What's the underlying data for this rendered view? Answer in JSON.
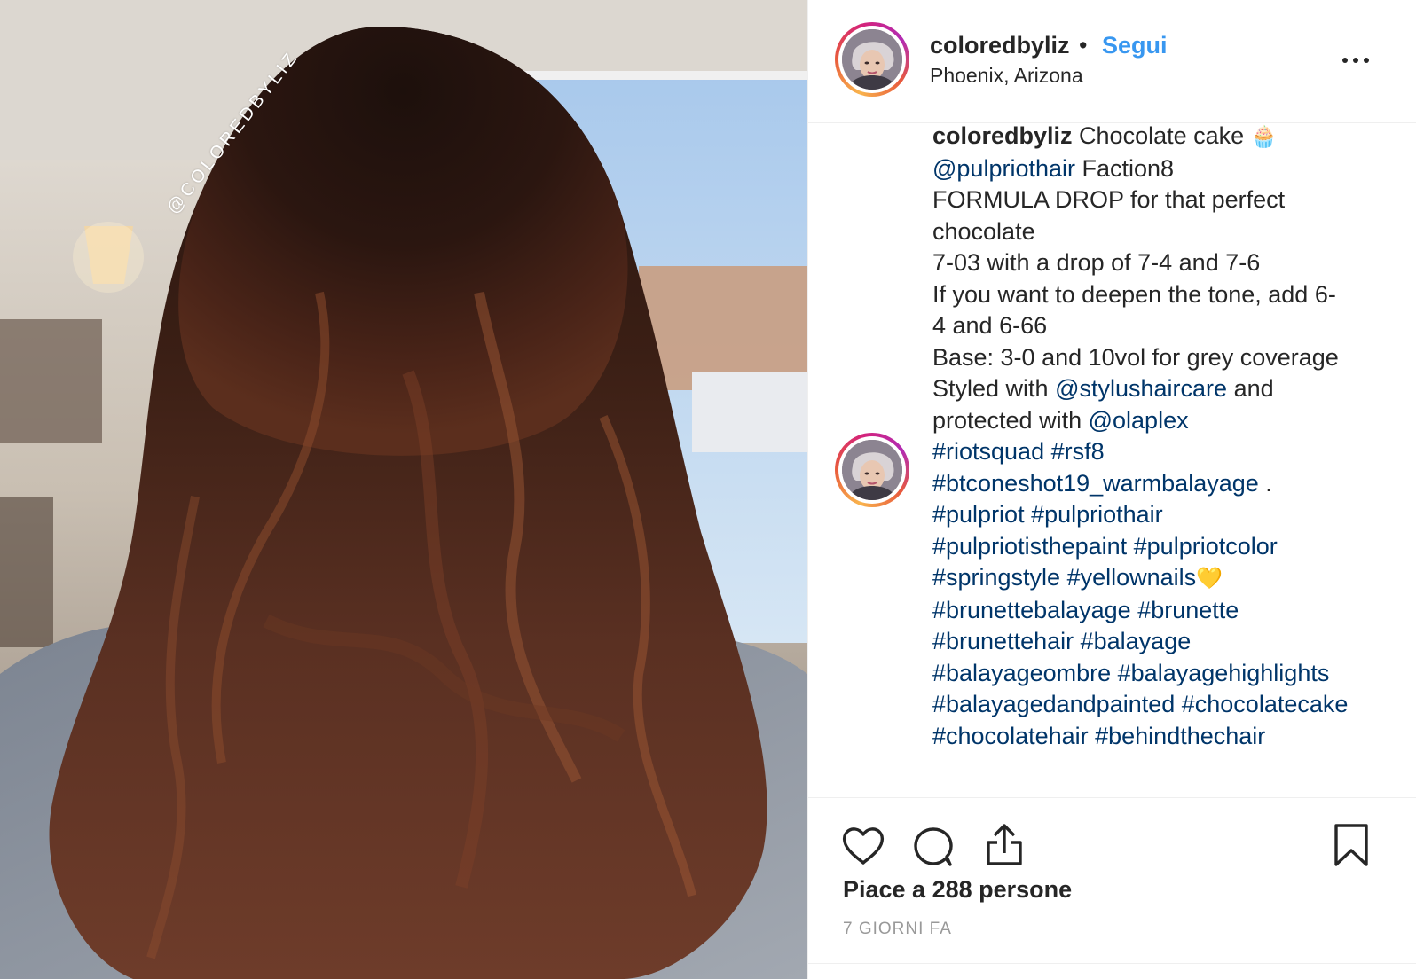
{
  "post": {
    "watermark": "@COLOREDBYLIZ"
  },
  "header": {
    "username": "coloredbyliz",
    "separator": "•",
    "follow_label": "Segui",
    "location": "Phoenix, Arizona",
    "more_icon": "more-horizontal-icon"
  },
  "caption": {
    "username": "coloredbyliz",
    "lines": [
      "Chocolate cake",
      "@pulpriothair",
      "Faction8",
      "FORMULA DROP for that perfect",
      "chocolate",
      "7-03 with a drop of 7-4 and 7-6",
      "If you want to deepen the tone, add 6-",
      "4 and 6-66",
      "Base: 3-0 and 10vol for grey coverage",
      "Styled with",
      "@stylushaircare",
      "and",
      "protected with",
      "@olaplex",
      "#riotsquad #rsf8",
      "#btconeshot19_warmbalayage",
      ".",
      "#pulpriot #pulpriothair",
      "#pulpriotisthepaint #pulpriotcolor",
      "#springstyle #yellownails",
      "#brunettebalayage #brunette",
      "#brunettehair #balayage",
      "#balayageombre #balayagehighlights",
      "#balayagedandpainted #chocolatecake",
      "#chocolatehair #behindthechair"
    ],
    "emoji_cake": "🧁",
    "emoji_heart": "💛"
  },
  "actions": {
    "like_icon": "heart-icon",
    "comment_icon": "comment-bubble-icon",
    "share_icon": "share-icon",
    "save_icon": "bookmark-icon",
    "likes_text": "Piace a 288 persone",
    "timestamp": "7 GIORNI FA"
  },
  "colors": {
    "link": "#003569",
    "follow": "#3897f0",
    "text": "#262626",
    "muted": "#999999"
  }
}
